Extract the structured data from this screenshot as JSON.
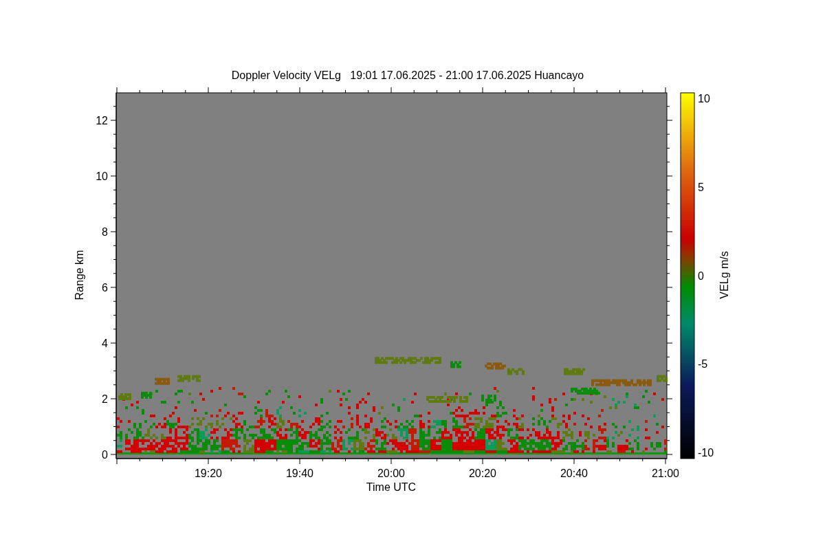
{
  "title": "Doppler Velocity VELg   19:01 17.06.2025 - 21:00 17.06.2025 Huancayo",
  "plot": {
    "xlabel": "Time UTC",
    "ylabel": "Range km",
    "xticks": [
      "19:20",
      "19:40",
      "20:00",
      "20:20",
      "20:40",
      "21:00"
    ],
    "yticks": [
      "12",
      "10",
      "8",
      "6",
      "4",
      "2",
      "0"
    ]
  },
  "colorbar": {
    "label": "VELg m/s",
    "ticks": [
      "10",
      "5",
      "0",
      "-5",
      "-10"
    ]
  }
}
